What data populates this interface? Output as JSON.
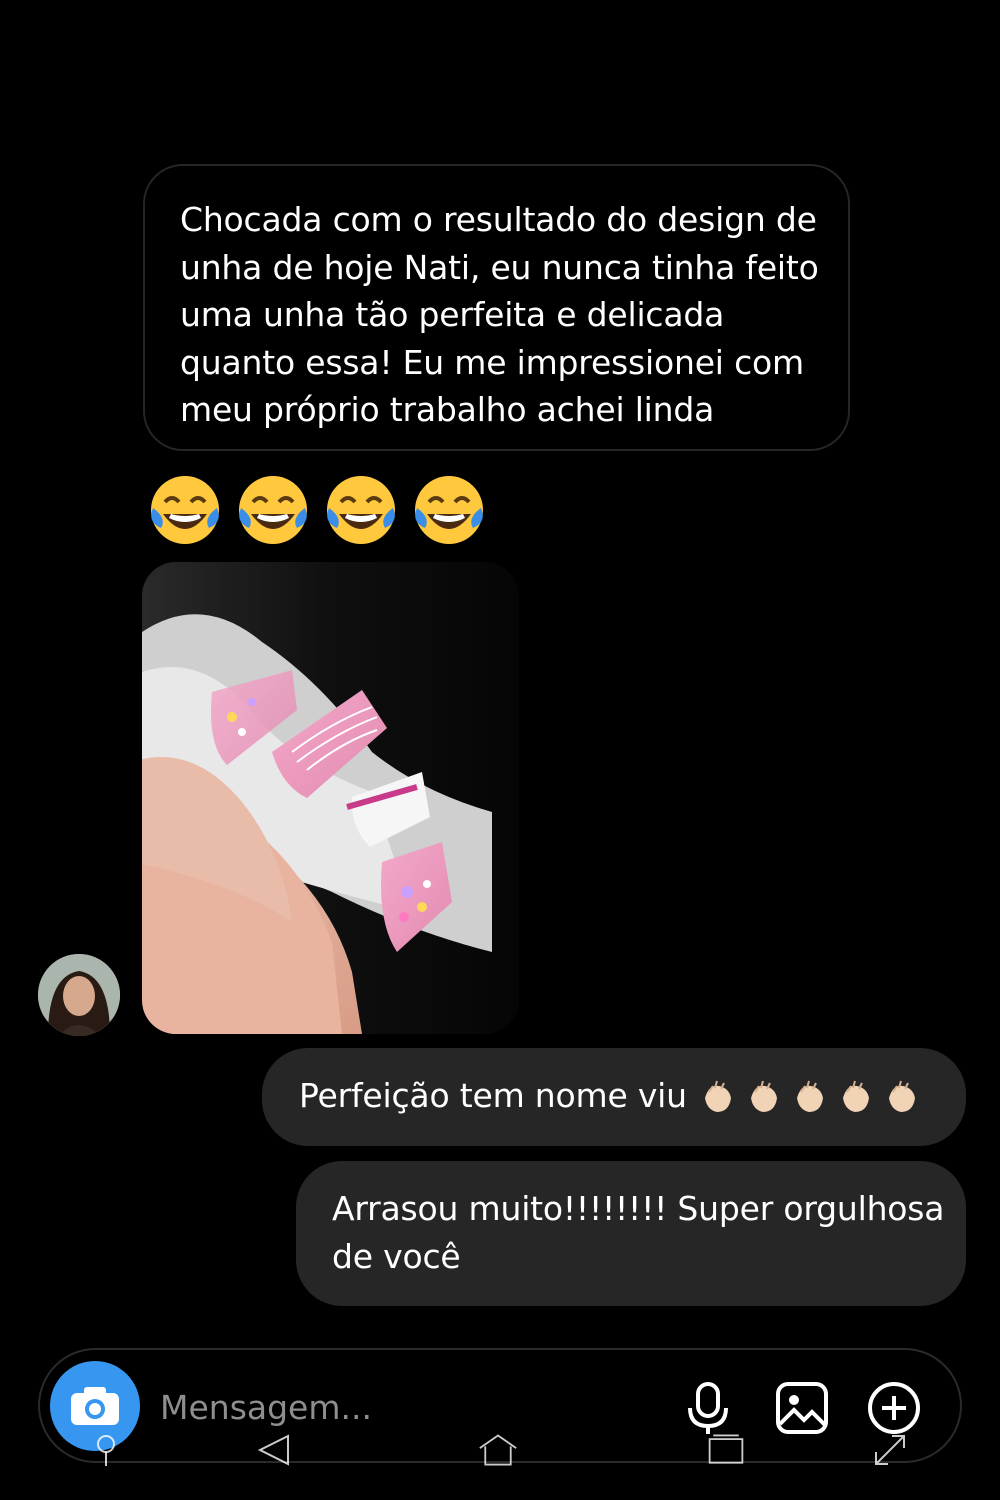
{
  "messages": {
    "incoming_text": "Chocada com o resultado do design de unha de hoje Nati, eu nunca tinha feito uma unha tão perfeita e delicada quanto essa! Eu me impressionei com meu próprio trabalho achei linda",
    "incoming_emojis": [
      "face-with-tears-of-joy",
      "face-with-tears-of-joy",
      "face-with-tears-of-joy",
      "face-with-tears-of-joy"
    ],
    "incoming_photo": "nail-design-photo",
    "outgoing": [
      {
        "text": "Perfeição tem nome viu",
        "emojis": [
          "clapping-hands",
          "clapping-hands",
          "clapping-hands",
          "clapping-hands",
          "clapping-hands"
        ]
      },
      {
        "text": "Arrasou muito!!!!!!!! Super orgulhosa de você"
      }
    ]
  },
  "composer": {
    "placeholder": "Mensagem...",
    "icons": [
      "camera-icon",
      "microphone-icon",
      "gallery-icon",
      "plus-icon"
    ]
  },
  "colors": {
    "background": "#000000",
    "bubble_out": "#262626",
    "bubble_in_border": "#262626",
    "camera_button": "#3797f0",
    "placeholder": "#8e8e8e"
  },
  "navbar": {
    "icons": [
      "location-icon",
      "back-icon",
      "home-icon",
      "recents-icon",
      "expand-icon"
    ]
  }
}
